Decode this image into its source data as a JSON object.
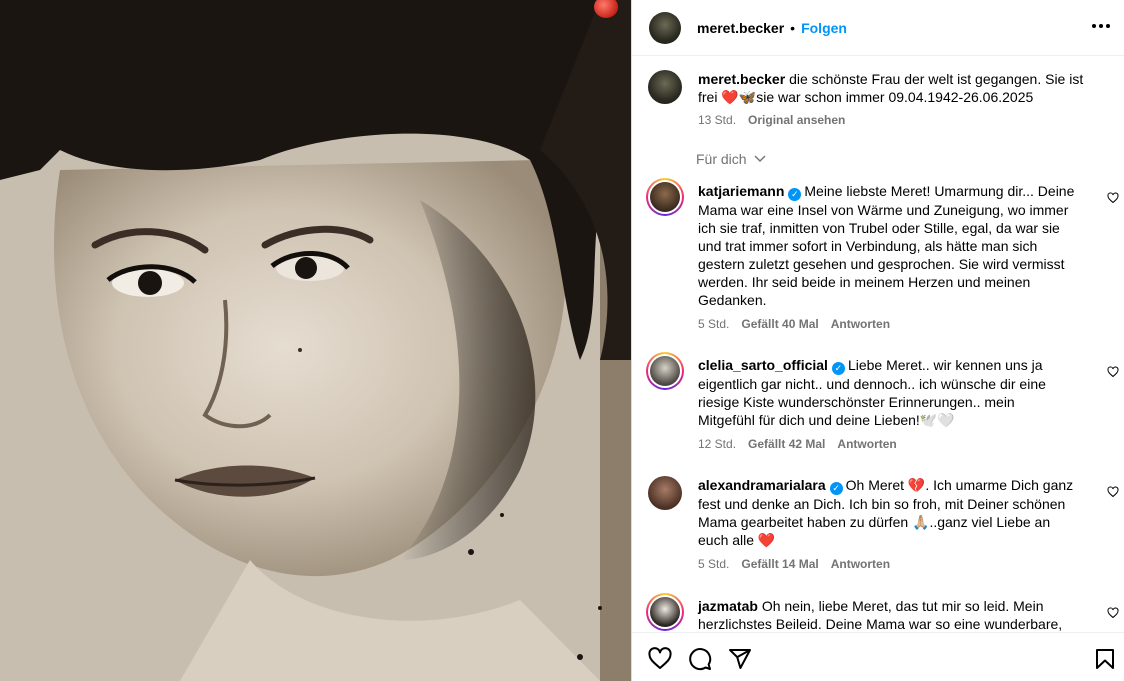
{
  "post": {
    "username": "meret.becker",
    "dot": "•",
    "follow_label": "Folgen",
    "caption_user": "meret.becker",
    "caption_text_line1": "die schönste Frau der welt ist gegangen. Sie ist",
    "caption_text_line2_a": "frei ",
    "caption_text_line2_b": "sie war schon immer 09.04.1942-26.06.2025",
    "caption_time": "13 Std.",
    "caption_original": "Original ansehen",
    "for_you_label": "Für dich"
  },
  "comments": [
    {
      "user": "katjariemann",
      "lines": [
        "Meine liebste Meret! Umarmung dir... Deine",
        "Mama war eine Insel von Wärme und Zuneigung, wo immer",
        "ich sie traf, inmitten von Trubel oder Stille, egal, da war sie",
        "und trat immer sofort in Verbindung, als hätte man sich",
        "gestern zuletzt gesehen und gesprochen. Sie wird vermisst",
        "werden. Ihr seid beide in meinem Herzen und meinen",
        "Gedanken."
      ],
      "time": "5 Std.",
      "likes": "Gefällt 40 Mal",
      "reply": "Antworten"
    },
    {
      "user": "clelia_sarto_official",
      "lines": [
        "Liebe Meret.. wir kennen uns ja",
        "eigentlich gar nicht.. und dennoch.. ich wünsche dir eine",
        "riesige Kiste wunderschönster Erinnerungen.. mein",
        "Mitgefühl für dich und deine Lieben!🕊️🤍"
      ],
      "time": "12 Std.",
      "likes": "Gefällt 42 Mal",
      "reply": "Antworten"
    },
    {
      "user": "alexandramarialara",
      "lines": [
        "Oh Meret 💔. Ich umarme Dich ganz",
        "fest und denke an Dich. Ich bin so froh, mit Deiner schönen",
        "Mama gearbeitet haben zu dürfen 🙏🏼..ganz viel Liebe an",
        "euch alle ❤️"
      ],
      "time": "5 Std.",
      "likes": "Gefällt 14 Mal",
      "reply": "Antworten"
    },
    {
      "user": "jazmatab",
      "lines": [
        "Oh nein, liebe Meret, das tut mir so leid. Mein",
        "herzlichstes Beileid. Deine Mama war so eine wunderbare,"
      ]
    }
  ],
  "icons": {
    "more": "more-options-icon",
    "like": "heart-icon",
    "comment": "comment-icon",
    "share": "share-icon",
    "save": "bookmark-icon",
    "verified": "verified-badge-icon",
    "chevron": "chevron-down-icon"
  },
  "colors": {
    "link": "#0095f6",
    "muted": "#737373",
    "heart": "#ed4956"
  }
}
